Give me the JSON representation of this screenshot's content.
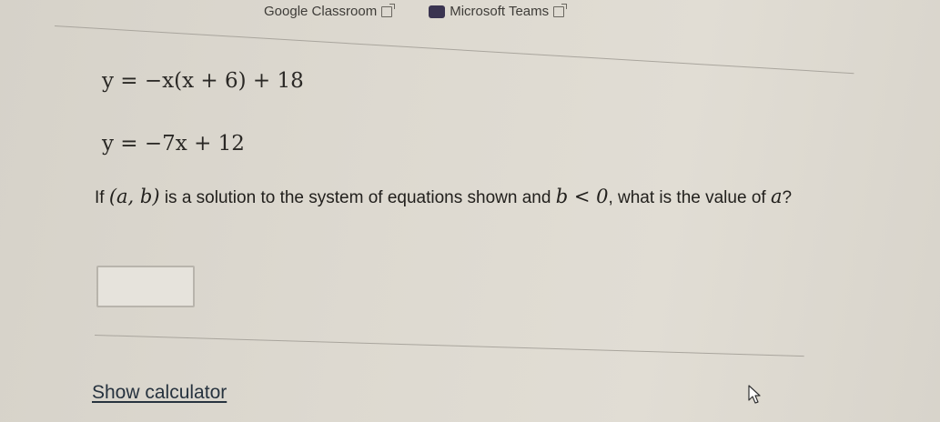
{
  "header": {
    "classroom_label": "Google Classroom",
    "teams_label": "Microsoft Teams"
  },
  "equations": {
    "eq1": "y = −x(x + 6) + 18",
    "eq2": "y = −7x + 12"
  },
  "question": {
    "part1": "If",
    "math1": "(a, b)",
    "part2": "is a solution to the system of equations shown and",
    "math2": "b < 0",
    "part3": ", what is the value of",
    "math3": "a",
    "part4": "?"
  },
  "answer": {
    "value": ""
  },
  "calculator": {
    "label": "Show calculator"
  }
}
